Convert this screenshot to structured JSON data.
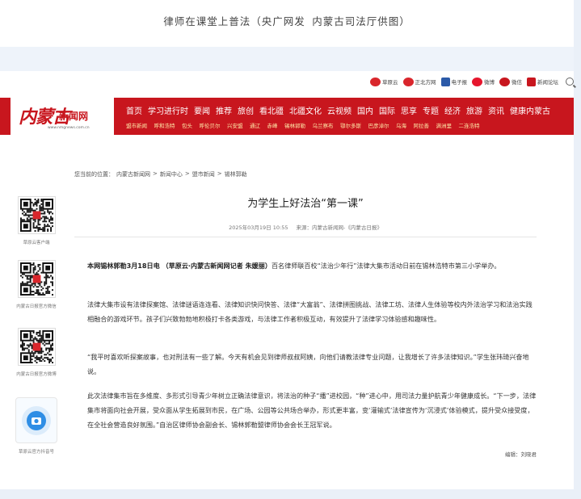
{
  "caption": "律师在课堂上普法（央广网发 内蒙古司法厅供图）",
  "share": {
    "items": [
      {
        "label": "草原云",
        "icon": "caoyuanyun-icon",
        "color": "#d9262c"
      },
      {
        "label": "正北方网",
        "icon": "zhengbeifang-icon",
        "color": "#d9262c"
      },
      {
        "label": "电子报",
        "icon": "newspaper-icon",
        "color": "#2b5aa8"
      },
      {
        "label": "微博",
        "icon": "weibo-icon",
        "color": "#e6162d"
      },
      {
        "label": "微信",
        "icon": "wechat-icon",
        "color": "#c8161e"
      },
      {
        "label": "新闻论坛",
        "icon": "forum-icon",
        "color": "#c8161e"
      }
    ],
    "search_icon": "search-icon"
  },
  "logo": {
    "main": "内蒙古",
    "sub": "新闻网",
    "url": "www.nmgnews.com.cn"
  },
  "nav": {
    "primary": [
      "首页",
      "学习进行时",
      "要闻",
      "推荐",
      "旅创",
      "看北疆",
      "北疆文化",
      "云视频",
      "国内",
      "国际",
      "思享",
      "专题",
      "经济",
      "旅游",
      "资讯",
      "健康内蒙古"
    ],
    "cities": [
      "盟市新闻",
      "呼和浩特",
      "包头",
      "呼伦贝尔",
      "兴安盟",
      "通辽",
      "赤峰",
      "锡林郭勒",
      "乌兰察布",
      "鄂尔多斯",
      "巴彦淖尔",
      "乌海",
      "阿拉善",
      "满洲里",
      "二连浩特"
    ]
  },
  "breadcrumb": {
    "prefix": "您当前的位置：",
    "items": [
      "内蒙古新闻网",
      "新闻中心",
      "盟市新闻",
      "锡林郭勒"
    ],
    "separator": ">"
  },
  "sidebar": [
    {
      "label": "草原云客户端"
    },
    {
      "label": "内蒙古日报官方微信"
    },
    {
      "label": "内蒙古日报官方微博"
    },
    {
      "label": "草原云官方抖音号"
    }
  ],
  "article": {
    "title": "为学生上好法治“第一课”",
    "date": "2025年03月19日 10:55",
    "source": "来源：内蒙古新闻网-《内蒙古日报》",
    "lead_bold": "本网锡林郭勒3月18日电 （草原云·内蒙古新闻网记者 朱媛丽）",
    "lead_rest": "百名律师联百校“法治少年行”法律大集市活动日前在锡林浩特市第三小学举办。",
    "p2": "法律大集市设有法律探案馆、法律谜语连连看、法律知识快问快答、法律“大富翁”、法律拼图挑战、法律工坊、法律人生体验等校内外法治学习和法治实践相融合的游戏环节。孩子们兴致勃勃地积极打卡各类游戏，与法律工作者积极互动，有效提升了法律学习体验感和趣味性。",
    "p3": "“我平时喜欢听探案故事，也对刑法有一些了解。今天有机会见到律师叔叔阿姨，向他们请教法律专业问题，让我增长了许多法律知识。”学生张玮琦兴奋地说。",
    "p4": "此次法律集市旨在多维度、多形式引导青少年树立正确法律意识，将法治的种子“播”进校园，“种”进心中，用司法力量护航青少年健康成长。“下一步，法律集市将面向社会开展，受众面从学生拓展到市民，在广场、公园等公共场合举办，形式更丰富，变‘灌输式’法律宣传为‘沉浸式’体验模式，提升受众接受度，在全社会营造良好氛围。”自治区律师协会副会长、锡林郭勒盟律师协会会长王冠军说。",
    "editor": "编辑：刘晓君"
  }
}
